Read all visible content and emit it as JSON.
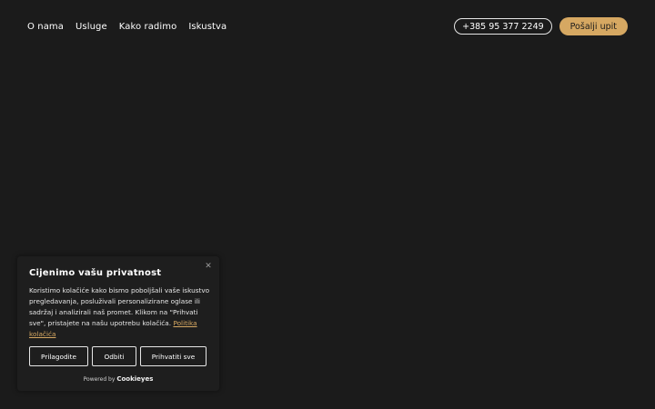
{
  "nav": {
    "links": [
      "O nama",
      "Usluge",
      "Kako radimo",
      "Iskustva"
    ],
    "phone": "+385 95 377 2249",
    "cta": "Pošalji upit"
  },
  "cookie_banner": {
    "title": "Cijenimo vašu privatnost",
    "text": "Koristimo kolačiće kako bismo poboljšali vaše iskustvo pregledavanja, posluživali personalizirane oglase ili sadržaj i analizirali naš promet. Klikom na \"Prihvati sve\", pristajete na našu upotrebu kolačića.",
    "policy_link": "Politika kolačića",
    "buttons": {
      "customize": "Prilagodite",
      "reject": "Odbiti",
      "accept": "Prihvatiti sve"
    },
    "powered_by": "Powered by",
    "brand": "Cookieyes",
    "close_icon": "close-icon"
  },
  "colors": {
    "background": "#1b1b1b",
    "accent": "#d6a862",
    "text": "#ffffff"
  }
}
